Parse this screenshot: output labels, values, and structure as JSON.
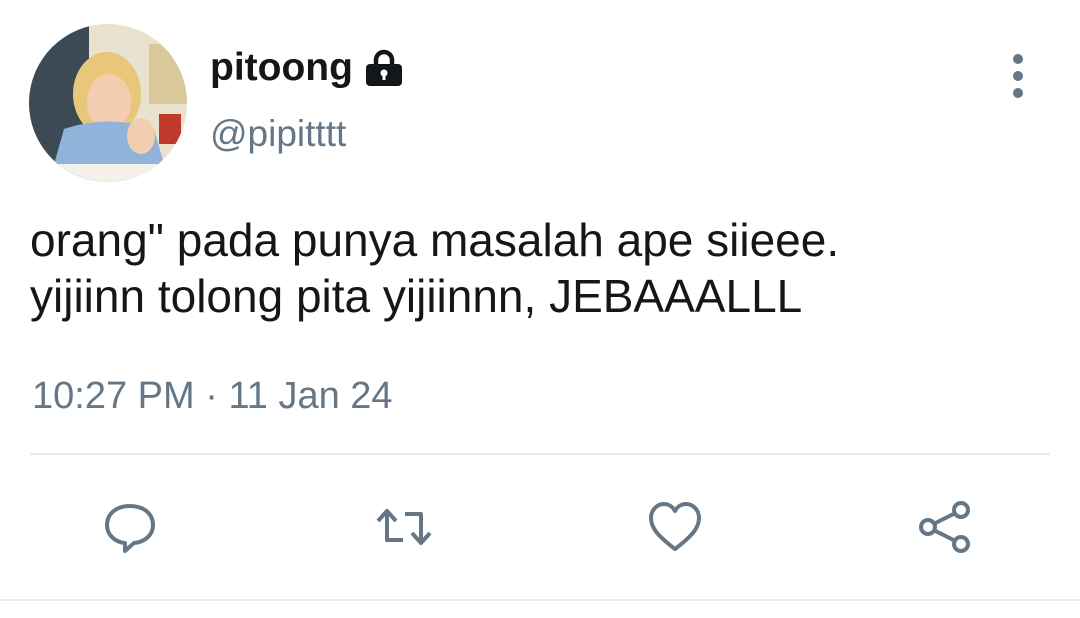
{
  "tweet": {
    "display_name": "pitoong",
    "handle": "@pipitttt",
    "text": "orang\" pada punya masalah ape siieee.\nyijiinn tolong pita yijiinnn, JEBAAALLL",
    "time": "10:27 PM",
    "separator": "·",
    "date": "11 Jan 24",
    "protected": true
  },
  "icons": {
    "lock": "lock-icon",
    "more": "more-vertical-icon",
    "reply": "reply-icon",
    "retweet": "retweet-icon",
    "like": "heart-icon",
    "share": "share-icon"
  },
  "colors": {
    "text": "#14171a",
    "secondary": "#657786",
    "divider": "#e6ecf0"
  }
}
